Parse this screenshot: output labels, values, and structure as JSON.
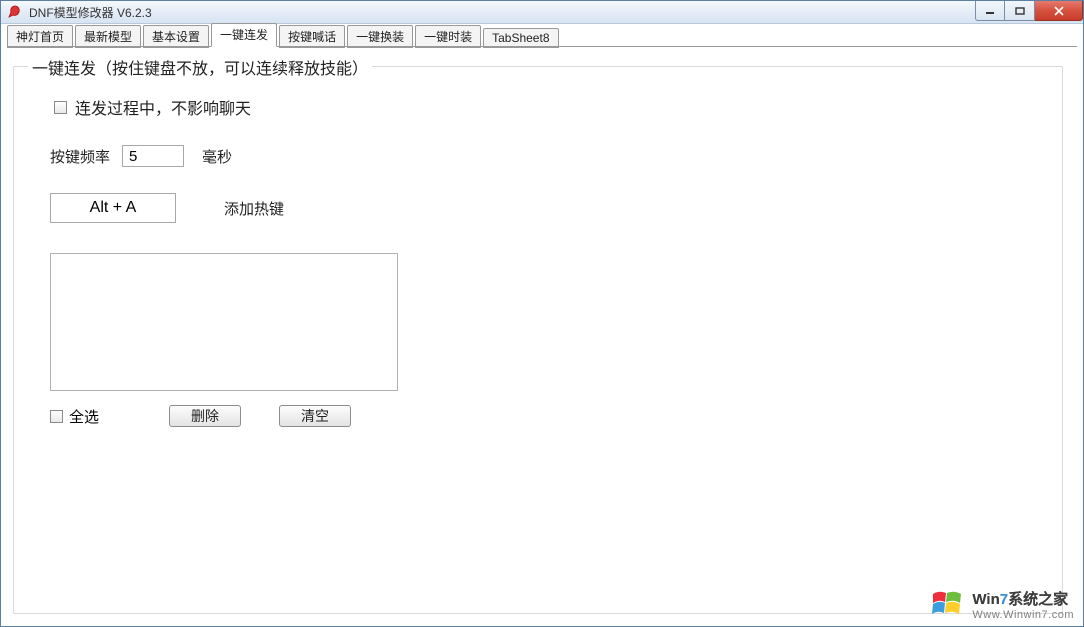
{
  "window": {
    "title": "DNF模型修改器  V6.2.3"
  },
  "tabs": [
    {
      "label": "神灯首页"
    },
    {
      "label": "最新模型"
    },
    {
      "label": "基本设置"
    },
    {
      "label": "一键连发",
      "active": true
    },
    {
      "label": "按键喊话"
    },
    {
      "label": "一键换装"
    },
    {
      "label": "一键时装"
    },
    {
      "label": "TabSheet8"
    }
  ],
  "group": {
    "title": "一键连发（按住键盘不放，可以连续释放技能）",
    "chat_checkbox_label": "连发过程中，不影响聊天",
    "freq_label": "按键频率",
    "freq_value": "5",
    "freq_unit": "毫秒",
    "hotkey_value": "Alt + A",
    "hotkey_label": "添加热键",
    "select_all_label": "全选",
    "delete_btn": "删除",
    "clear_btn": "清空"
  },
  "watermark": {
    "line1_prefix": "Win",
    "line1_seven": "7",
    "line1_suffix": "系统之家",
    "line2": "Www.Winwin7.com"
  }
}
